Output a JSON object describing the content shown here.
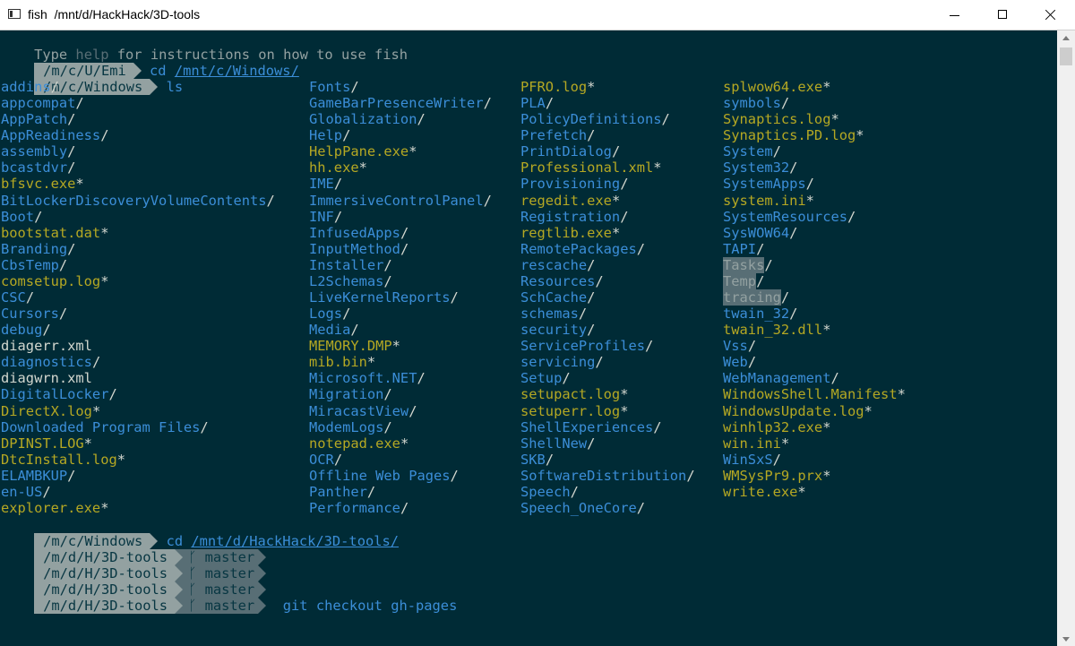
{
  "window": {
    "title": "fish  /mnt/d/HackHack/3D-tools",
    "icon": "terminal-window-icon"
  },
  "welcome": {
    "part1": "Type ",
    "help_word": "help",
    "part2": " for instructions on how to use fish"
  },
  "prompts": [
    {
      "path": "/m/c/U/Emi",
      "command": "cd ",
      "argument": "/mnt/c/Windows/"
    },
    {
      "path": "/m/c/Windows",
      "command": "ls"
    },
    {
      "path": "/m/c/Windows",
      "command": "cd ",
      "argument": "/mnt/d/HackHack/3D-tools/"
    }
  ],
  "git_prompts": [
    {
      "path": "/m/d/H/3D-tools",
      "branch": "master",
      "command": ""
    },
    {
      "path": "/m/d/H/3D-tools",
      "branch": "master",
      "command": ""
    },
    {
      "path": "/m/d/H/3D-tools",
      "branch": "master",
      "command": ""
    },
    {
      "path": "/m/d/H/3D-tools",
      "branch": "master",
      "command": "git checkout gh-pages"
    }
  ],
  "branch_glyph": "ᚴ",
  "listing": {
    "columns": [
      [
        {
          "name": "addins",
          "suffix": "/",
          "type": "dir"
        },
        {
          "name": "appcompat",
          "suffix": "/",
          "type": "dir"
        },
        {
          "name": "AppPatch",
          "suffix": "/",
          "type": "dir"
        },
        {
          "name": "AppReadiness",
          "suffix": "/",
          "type": "dir"
        },
        {
          "name": "assembly",
          "suffix": "/",
          "type": "dir"
        },
        {
          "name": "bcastdvr",
          "suffix": "/",
          "type": "dir"
        },
        {
          "name": "bfsvc.exe",
          "suffix": "*",
          "type": "exec"
        },
        {
          "name": "BitLockerDiscoveryVolumeContents",
          "suffix": "/",
          "type": "dir"
        },
        {
          "name": "Boot",
          "suffix": "/",
          "type": "dir"
        },
        {
          "name": "bootstat.dat",
          "suffix": "*",
          "type": "exec"
        },
        {
          "name": "Branding",
          "suffix": "/",
          "type": "dir"
        },
        {
          "name": "CbsTemp",
          "suffix": "/",
          "type": "dir"
        },
        {
          "name": "comsetup.log",
          "suffix": "*",
          "type": "exec"
        },
        {
          "name": "CSC",
          "suffix": "/",
          "type": "dir"
        },
        {
          "name": "Cursors",
          "suffix": "/",
          "type": "dir"
        },
        {
          "name": "debug",
          "suffix": "/",
          "type": "dir"
        },
        {
          "name": "diagerr.xml",
          "suffix": "",
          "type": "file"
        },
        {
          "name": "diagnostics",
          "suffix": "/",
          "type": "dir"
        },
        {
          "name": "diagwrn.xml",
          "suffix": "",
          "type": "file"
        },
        {
          "name": "DigitalLocker",
          "suffix": "/",
          "type": "dir"
        },
        {
          "name": "DirectX.log",
          "suffix": "*",
          "type": "exec"
        },
        {
          "name": "Downloaded Program Files",
          "suffix": "/",
          "type": "dir"
        },
        {
          "name": "DPINST.LOG",
          "suffix": "*",
          "type": "exec"
        },
        {
          "name": "DtcInstall.log",
          "suffix": "*",
          "type": "exec"
        },
        {
          "name": "ELAMBKUP",
          "suffix": "/",
          "type": "dir"
        },
        {
          "name": "en-US",
          "suffix": "/",
          "type": "dir"
        },
        {
          "name": "explorer.exe",
          "suffix": "*",
          "type": "exec"
        }
      ],
      [
        {
          "name": "Fonts",
          "suffix": "/",
          "type": "dir"
        },
        {
          "name": "GameBarPresenceWriter",
          "suffix": "/",
          "type": "dir"
        },
        {
          "name": "Globalization",
          "suffix": "/",
          "type": "dir"
        },
        {
          "name": "Help",
          "suffix": "/",
          "type": "dir"
        },
        {
          "name": "HelpPane.exe",
          "suffix": "*",
          "type": "exec"
        },
        {
          "name": "hh.exe",
          "suffix": "*",
          "type": "exec"
        },
        {
          "name": "IME",
          "suffix": "/",
          "type": "dir"
        },
        {
          "name": "ImmersiveControlPanel",
          "suffix": "/",
          "type": "dir"
        },
        {
          "name": "INF",
          "suffix": "/",
          "type": "dir"
        },
        {
          "name": "InfusedApps",
          "suffix": "/",
          "type": "dir"
        },
        {
          "name": "InputMethod",
          "suffix": "/",
          "type": "dir"
        },
        {
          "name": "Installer",
          "suffix": "/",
          "type": "dir"
        },
        {
          "name": "L2Schemas",
          "suffix": "/",
          "type": "dir"
        },
        {
          "name": "LiveKernelReports",
          "suffix": "/",
          "type": "dir"
        },
        {
          "name": "Logs",
          "suffix": "/",
          "type": "dir"
        },
        {
          "name": "Media",
          "suffix": "/",
          "type": "dir"
        },
        {
          "name": "MEMORY.DMP",
          "suffix": "*",
          "type": "exec"
        },
        {
          "name": "mib.bin",
          "suffix": "*",
          "type": "exec"
        },
        {
          "name": "Microsoft.NET",
          "suffix": "/",
          "type": "dir"
        },
        {
          "name": "Migration",
          "suffix": "/",
          "type": "dir"
        },
        {
          "name": "MiracastView",
          "suffix": "/",
          "type": "dir"
        },
        {
          "name": "ModemLogs",
          "suffix": "/",
          "type": "dir"
        },
        {
          "name": "notepad.exe",
          "suffix": "*",
          "type": "exec"
        },
        {
          "name": "OCR",
          "suffix": "/",
          "type": "dir"
        },
        {
          "name": "Offline Web Pages",
          "suffix": "/",
          "type": "dir"
        },
        {
          "name": "Panther",
          "suffix": "/",
          "type": "dir"
        },
        {
          "name": "Performance",
          "suffix": "/",
          "type": "dir"
        }
      ],
      [
        {
          "name": "PFRO.log",
          "suffix": "*",
          "type": "exec"
        },
        {
          "name": "PLA",
          "suffix": "/",
          "type": "dir"
        },
        {
          "name": "PolicyDefinitions",
          "suffix": "/",
          "type": "dir"
        },
        {
          "name": "Prefetch",
          "suffix": "/",
          "type": "dir"
        },
        {
          "name": "PrintDialog",
          "suffix": "/",
          "type": "dir"
        },
        {
          "name": "Professional.xml",
          "suffix": "*",
          "type": "exec"
        },
        {
          "name": "Provisioning",
          "suffix": "/",
          "type": "dir"
        },
        {
          "name": "regedit.exe",
          "suffix": "*",
          "type": "exec"
        },
        {
          "name": "Registration",
          "suffix": "/",
          "type": "dir"
        },
        {
          "name": "regtlib.exe",
          "suffix": "*",
          "type": "exec"
        },
        {
          "name": "RemotePackages",
          "suffix": "/",
          "type": "dir"
        },
        {
          "name": "rescache",
          "suffix": "/",
          "type": "dir"
        },
        {
          "name": "Resources",
          "suffix": "/",
          "type": "dir"
        },
        {
          "name": "SchCache",
          "suffix": "/",
          "type": "dir"
        },
        {
          "name": "schemas",
          "suffix": "/",
          "type": "dir"
        },
        {
          "name": "security",
          "suffix": "/",
          "type": "dir"
        },
        {
          "name": "ServiceProfiles",
          "suffix": "/",
          "type": "dir"
        },
        {
          "name": "servicing",
          "suffix": "/",
          "type": "dir"
        },
        {
          "name": "Setup",
          "suffix": "/",
          "type": "dir"
        },
        {
          "name": "setupact.log",
          "suffix": "*",
          "type": "exec"
        },
        {
          "name": "setuperr.log",
          "suffix": "*",
          "type": "exec"
        },
        {
          "name": "ShellExperiences",
          "suffix": "/",
          "type": "dir"
        },
        {
          "name": "ShellNew",
          "suffix": "/",
          "type": "dir"
        },
        {
          "name": "SKB",
          "suffix": "/",
          "type": "dir"
        },
        {
          "name": "SoftwareDistribution",
          "suffix": "/",
          "type": "dir"
        },
        {
          "name": "Speech",
          "suffix": "/",
          "type": "dir"
        },
        {
          "name": "Speech_OneCore",
          "suffix": "/",
          "type": "dir"
        }
      ],
      [
        {
          "name": "splwow64.exe",
          "suffix": "*",
          "type": "exec"
        },
        {
          "name": "symbols",
          "suffix": "/",
          "type": "dir"
        },
        {
          "name": "Synaptics.log",
          "suffix": "*",
          "type": "exec"
        },
        {
          "name": "Synaptics.PD.log",
          "suffix": "*",
          "type": "exec"
        },
        {
          "name": "System",
          "suffix": "/",
          "type": "dir"
        },
        {
          "name": "System32",
          "suffix": "/",
          "type": "dir"
        },
        {
          "name": "SystemApps",
          "suffix": "/",
          "type": "dir"
        },
        {
          "name": "system.ini",
          "suffix": "*",
          "type": "exec"
        },
        {
          "name": "SystemResources",
          "suffix": "/",
          "type": "dir"
        },
        {
          "name": "SysWOW64",
          "suffix": "/",
          "type": "dir"
        },
        {
          "name": "TAPI",
          "suffix": "/",
          "type": "dir"
        },
        {
          "name": "Tasks",
          "suffix": "/",
          "type": "hl"
        },
        {
          "name": "Temp",
          "suffix": "/",
          "type": "hl"
        },
        {
          "name": "tracing",
          "suffix": "/",
          "type": "hl"
        },
        {
          "name": "twain_32",
          "suffix": "/",
          "type": "dir"
        },
        {
          "name": "twain_32.dll",
          "suffix": "*",
          "type": "exec"
        },
        {
          "name": "Vss",
          "suffix": "/",
          "type": "dir"
        },
        {
          "name": "Web",
          "suffix": "/",
          "type": "dir"
        },
        {
          "name": "WebManagement",
          "suffix": "/",
          "type": "dir"
        },
        {
          "name": "WindowsShell.Manifest",
          "suffix": "*",
          "type": "exec"
        },
        {
          "name": "WindowsUpdate.log",
          "suffix": "*",
          "type": "exec"
        },
        {
          "name": "winhlp32.exe",
          "suffix": "*",
          "type": "exec"
        },
        {
          "name": "win.ini",
          "suffix": "*",
          "type": "exec"
        },
        {
          "name": "WinSxS",
          "suffix": "/",
          "type": "dir"
        },
        {
          "name": "WMSysPr9.prx",
          "suffix": "*",
          "type": "exec"
        },
        {
          "name": "write.exe",
          "suffix": "*",
          "type": "exec"
        }
      ]
    ]
  },
  "colors": {
    "background": "#002b36",
    "directory": "#3b8ed8",
    "executable": "#b5a823",
    "file": "#d3d7cf",
    "prompt_light": "#93a1a1",
    "prompt_dark": "#586e75"
  }
}
